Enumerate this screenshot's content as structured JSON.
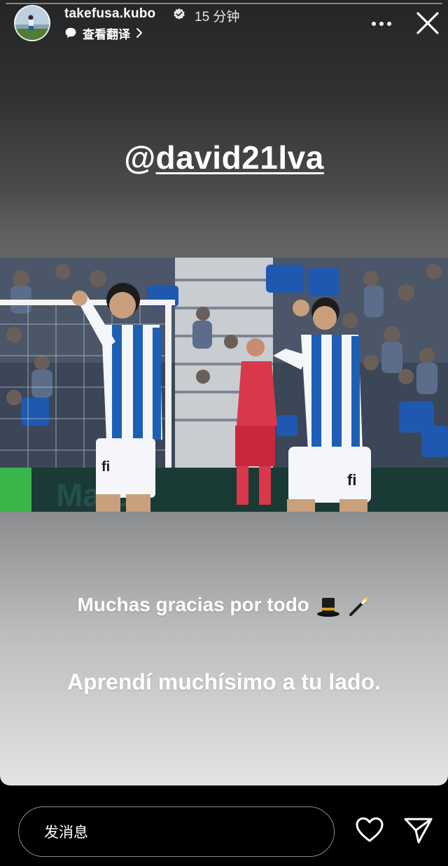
{
  "header": {
    "username": "takefusa.kubo",
    "time": "15 分钟",
    "translate_label": "查看翻译",
    "icons": {
      "verified": "verified-badge-icon",
      "translate": "translate-icon",
      "more": "more-options-icon",
      "close": "close-icon"
    }
  },
  "story": {
    "mention_at": "@",
    "mention_name": "david21lva",
    "photo_signage": "Marco",
    "caption_line1": "Muchas gracias por todo",
    "caption_line2": "Aprendí muchísimo a tu lado.",
    "caption_emojis": [
      "top-hat-icon",
      "magic-wand-icon"
    ]
  },
  "footer": {
    "message_placeholder": "发消息",
    "icons": {
      "like": "heart-icon",
      "share": "send-icon"
    }
  },
  "colors": {
    "background": "#000000",
    "text": "#ffffff",
    "home_blue": "#1d5fb4"
  }
}
